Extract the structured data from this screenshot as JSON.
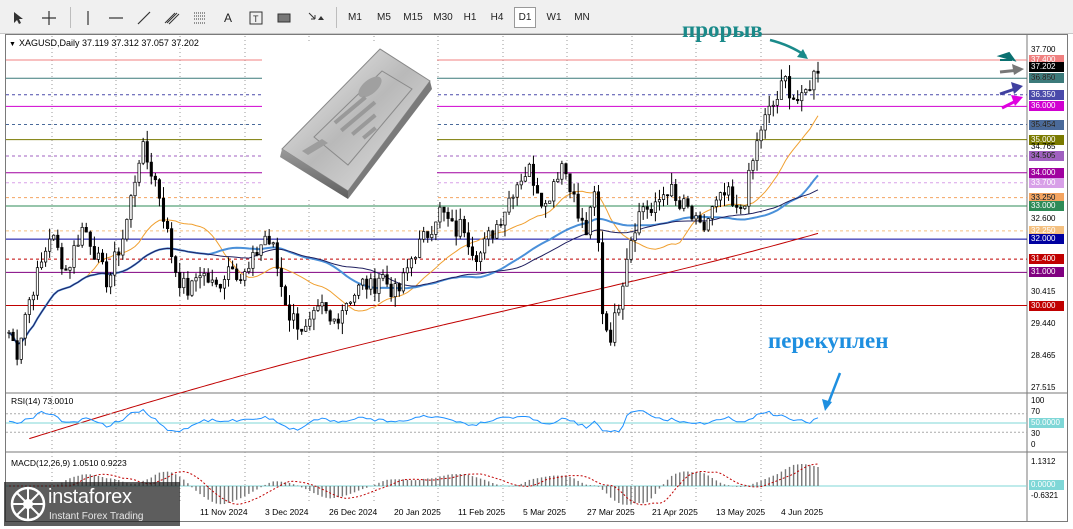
{
  "toolbar": {
    "timeframes": [
      "M1",
      "M5",
      "M15",
      "M30",
      "H1",
      "H4",
      "D1",
      "W1",
      "MN"
    ],
    "active_timeframe": "D1"
  },
  "chart": {
    "symbol_label": "XAGUSD,Daily",
    "ohlc": "37.119 37.312 37.057 37.202"
  },
  "annotations": {
    "breakout": "прорыв",
    "overbought": "перекуплен"
  },
  "price_axis": {
    "ticks": [
      "37.700",
      "36.850",
      "35.454",
      "34.765",
      "34.505",
      "33.250",
      "32.600",
      "30.415",
      "29.440",
      "28.465",
      "27.515"
    ],
    "level_labels": [
      {
        "text": "37.400",
        "color": "#f08080"
      },
      {
        "text": "37.202",
        "color": "#000000"
      },
      {
        "text": "36.850",
        "color": "#3c7a7a"
      },
      {
        "text": "36.350",
        "color": "#4a4aaa"
      },
      {
        "text": "36.000",
        "color": "#d000d0"
      },
      {
        "text": "35.454",
        "color": "#4a6a9a"
      },
      {
        "text": "35.000",
        "color": "#7a7a00"
      },
      {
        "text": "34.505",
        "color": "#a060c0"
      },
      {
        "text": "34.000",
        "color": "#a000a0"
      },
      {
        "text": "33.700",
        "color": "#d8a0e8"
      },
      {
        "text": "33.250",
        "color": "#f4a460"
      },
      {
        "text": "33.000",
        "color": "#2e8b57"
      },
      {
        "text": "32.250",
        "color": "#f4c080"
      },
      {
        "text": "32.000",
        "color": "#0000a0"
      },
      {
        "text": "31.400",
        "color": "#c00000"
      },
      {
        "text": "31.000",
        "color": "#800080"
      },
      {
        "text": "30.000",
        "color": "#c00000"
      }
    ]
  },
  "rsi": {
    "label": "RSI(14) 73.0010",
    "ticks": [
      "100",
      "70",
      "50.0000",
      "30",
      "0"
    ]
  },
  "macd": {
    "label": "MACD(12,26,9) 1.0510 0.9223",
    "ticks": [
      "1.1312",
      "0.0000",
      "-0.6321"
    ]
  },
  "dates": [
    "11 Nov 2024",
    "3 Dec 2024",
    "26 Dec 2024",
    "20 Jan 2025",
    "11 Feb 2025",
    "5 Mar 2025",
    "27 Mar 2025",
    "21 Apr 2025",
    "13 May 2025",
    "4 Jun 2025"
  ],
  "logo": {
    "brand": "instaforex",
    "tagline": "Instant Forex Trading"
  },
  "chart_data": {
    "type": "candlestick",
    "instrument": "XAGUSD",
    "timeframe": "Daily",
    "close_path": [
      29.2,
      28.6,
      29.8,
      30.6,
      31.3,
      32.2,
      31.6,
      31.0,
      31.8,
      32.4,
      31.9,
      31.2,
      30.7,
      31.5,
      32.2,
      33.5,
      34.8,
      34.2,
      33.6,
      32.4,
      31.2,
      30.6,
      30.4,
      31.1,
      30.8,
      30.5,
      30.9,
      31.4,
      30.8,
      31.0,
      31.6,
      32.1,
      31.7,
      30.6,
      29.7,
      29.5,
      29.2,
      29.6,
      29.9,
      29.4,
      29.8,
      30.2,
      30.4,
      30.7,
      30.5,
      31.0,
      30.6,
      30.3,
      30.9,
      31.6,
      31.9,
      32.3,
      32.9,
      32.6,
      32.2,
      32.5,
      31.8,
      31.5,
      32.0,
      32.4,
      32.9,
      33.5,
      33.9,
      34.1,
      33.6,
      33.0,
      33.8,
      34.3,
      33.7,
      32.6,
      32.2,
      33.4,
      29.5,
      29.1,
      30.3,
      31.8,
      32.6,
      33.1,
      32.7,
      33.3,
      33.6,
      32.9,
      33.0,
      32.5,
      32.2,
      32.8,
      33.1,
      33.4,
      32.7,
      33.1,
      34.2,
      35.3,
      35.8,
      36.2,
      36.8,
      36.3,
      36.1,
      36.7,
      37.2
    ]
  }
}
